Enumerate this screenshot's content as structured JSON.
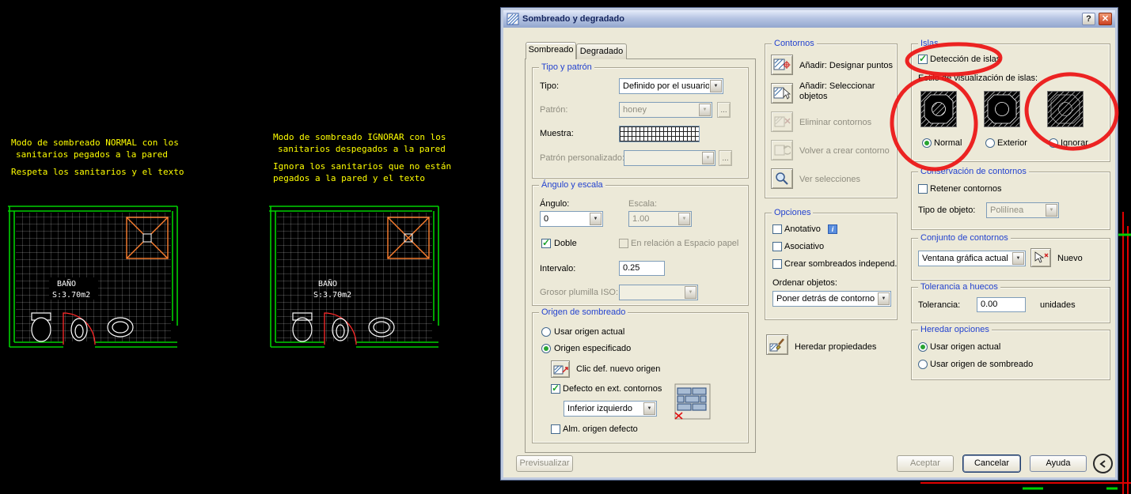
{
  "colors": {
    "cad_text_yellow": "#ffff00",
    "cad_wall_green": "#00d000",
    "cad_door_red": "#ff2a2a",
    "cad_shower_orange": "#ff8030",
    "annotation_red": "#ed1515",
    "dialog_bg": "#ece9d8",
    "group_title_blue": "#2342cf",
    "check_green": "#1da22b"
  },
  "drawing": {
    "note_normal": [
      "Modo de sombreado NORMAL con los",
      "sanitarios pegados a la pared",
      "Respeta los sanitarios y el texto"
    ],
    "note_ignore": [
      "Modo de sombreado IGNORAR con los",
      "sanitarios despegados a la pared",
      "Ignora los sanitarios que no están",
      "pegados a la pared y el texto"
    ],
    "bathroom_label": "BAÑO",
    "bathroom_area": "S:3.70m2"
  },
  "dialog": {
    "title": "Sombreado y degradado",
    "help_icon": "?",
    "close_icon": "✕",
    "ellipsis": "...",
    "tabs": {
      "hatch": "Sombreado",
      "gradient": "Degradado"
    },
    "type_pattern": {
      "title": "Tipo y patrón",
      "type_label": "Tipo:",
      "type_value": "Definido por el usuario",
      "pattern_label": "Patrón:",
      "pattern_value": "honey",
      "sample_label": "Muestra:",
      "custom_label": "Patrón personalizado:"
    },
    "angle_scale": {
      "title": "Ángulo y escala",
      "angle_label": "Ángulo:",
      "angle_value": "0",
      "scale_label": "Escala:",
      "scale_value": "1.00",
      "double_label": "Doble",
      "paper_space_label": "En relación a Espacio papel",
      "spacing_label": "Intervalo:",
      "spacing_value": "0.25",
      "iso_pen_label": "Grosor plumilla ISO:"
    },
    "origin": {
      "title": "Origen de sombreado",
      "use_current": "Usar origen actual",
      "specified": "Origen especificado",
      "click_set": "Clic def. nuevo origen",
      "default_ext": "Defecto en ext. contornos",
      "position_value": "Inferior izquierdo",
      "store_default": "Alm. origen defecto"
    },
    "boundaries": {
      "title": "Contornos",
      "add_points": "Añadir: Designar puntos",
      "add_objects_line1": "Añadir: Seleccionar",
      "add_objects_line2": "objetos",
      "remove": "Eliminar contornos",
      "recreate": "Volver a crear contorno",
      "view_selections": "Ver selecciones"
    },
    "options": {
      "title": "Opciones",
      "annotative": "Anotativo",
      "info_icon": "i",
      "associative": "Asociativo",
      "independent": "Crear sombreados independ.",
      "draw_order_label": "Ordenar objetos:",
      "draw_order_value": "Poner detrás de contorno"
    },
    "inherit_button": "Heredar propiedades",
    "islands": {
      "title": "Islas",
      "detection": "Detección de islas",
      "style_label": "Estilo de visualización de islas:",
      "normal": "Normal",
      "exterior": "Exterior",
      "ignore": "Ignorar"
    },
    "retention": {
      "title": "Conservación de contornos",
      "retain": "Retener contornos",
      "object_type_label": "Tipo de objeto:",
      "object_type_value": "Polilínea"
    },
    "boundary_set": {
      "title": "Conjunto de contornos",
      "value": "Ventana gráfica actual",
      "new_label": "Nuevo"
    },
    "gap_tolerance": {
      "title": "Tolerancia a huecos",
      "label": "Tolerancia:",
      "value": "0.00",
      "units": "unidades"
    },
    "inherit_options": {
      "title": "Heredar opciones",
      "use_current": "Usar origen actual",
      "use_hatch_origin": "Usar origen de sombreado"
    },
    "footer": {
      "preview": "Previsualizar",
      "ok": "Aceptar",
      "cancel": "Cancelar",
      "help": "Ayuda"
    }
  }
}
